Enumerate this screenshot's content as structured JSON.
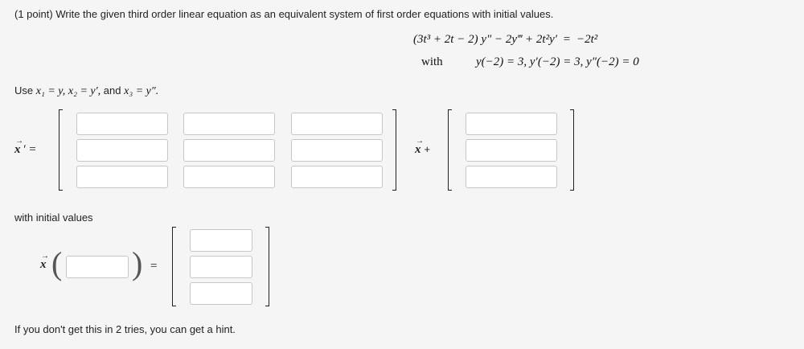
{
  "problem": {
    "points": "(1 point)",
    "prompt": "Write the given third order linear equation as an equivalent system of first order equations with initial values."
  },
  "equation": {
    "lhs": "(3t³ + 2t − 2) y″ − 2y‴ + 2t²y′",
    "equals": "=",
    "rhs": "−2t²",
    "with_label": "with",
    "initial_conditions": "y(−2) = 3,  y′(−2) = 3,  y″(−2) = 0"
  },
  "substitution": {
    "use": "Use",
    "x1": "x₁ = y,",
    "x2": "x₂ = y′,",
    "and": "and",
    "x3": "x₃ = y″."
  },
  "system": {
    "lhs": "x′ =",
    "matrix_rows": 3,
    "matrix_cols": 3,
    "times_x_plus": "x +",
    "forcing_rows": 3
  },
  "initial": {
    "label": "with initial values",
    "vector_symbol": "x",
    "equals": "="
  },
  "footer": {
    "hint": "If you don't get this in 2 tries, you can get a hint."
  }
}
